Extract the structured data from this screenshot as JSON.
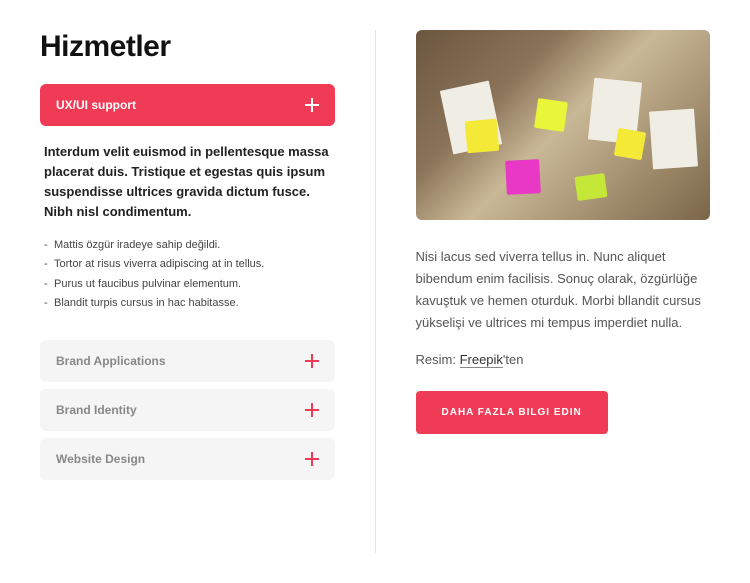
{
  "heading": "Hizmetler",
  "accordion": [
    {
      "label": "UX/UI support",
      "expanded": true,
      "intro": "Interdum velit euismod in pellentesque massa placerat duis. Tristique et egestas quis ipsum suspendisse ultrices gravida dictum fusce. Nibh nisl condimentum.",
      "bullets": [
        "Mattis özgür iradeye sahip değildi.",
        "Tortor at risus viverra adipiscing at in tellus.",
        "Purus ut faucibus pulvinar elementum.",
        "Blandit turpis cursus in hac habitasse."
      ]
    },
    {
      "label": "Brand Applications",
      "expanded": false
    },
    {
      "label": "Brand Identity",
      "expanded": false
    },
    {
      "label": "Website Design",
      "expanded": false
    }
  ],
  "right": {
    "description": "Nisi lacus sed viverra tellus in. Nunc aliquet bibendum enim facilisis. Sonuç olarak, özgürlüğe kavuştuk ve hemen oturduk. Morbi bllandit cursus yükselişi ve ultrices mi tempus imperdiet nulla.",
    "credit_prefix": "Resim: ",
    "credit_link": "Freepik",
    "credit_suffix": "'ten",
    "cta": "DAHA FAZLA BILGI EDIN"
  },
  "colors": {
    "accent": "#ef3b56"
  }
}
